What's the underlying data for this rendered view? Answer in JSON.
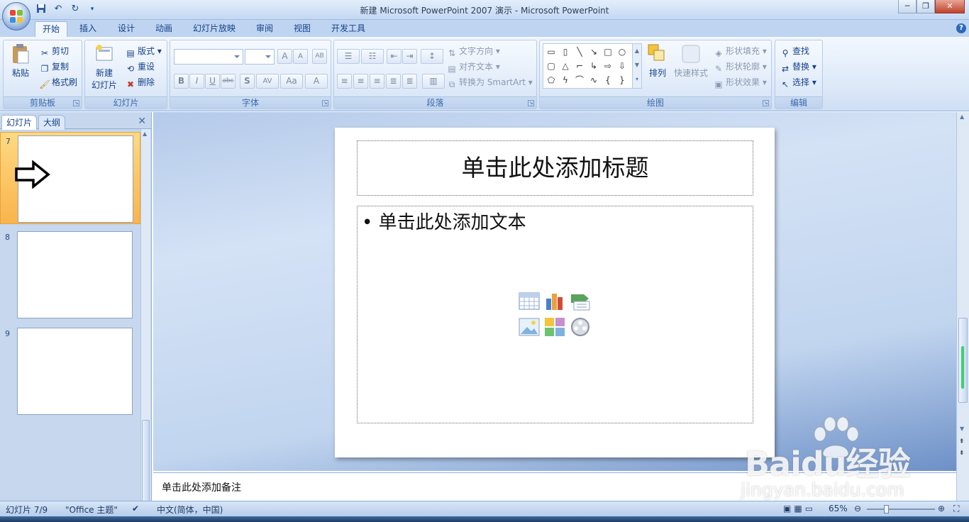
{
  "window": {
    "title": "新建 Microsoft PowerPoint 2007 演示 - Microsoft PowerPoint",
    "minimize": "─",
    "restore": "❐",
    "close": "✕"
  },
  "qat": {
    "save_icon": "save-icon",
    "undo_icon": "undo-icon",
    "redo_icon": "redo-icon",
    "customize_icon": "customize-icon"
  },
  "tabs": [
    "开始",
    "插入",
    "设计",
    "动画",
    "幻灯片放映",
    "审阅",
    "视图",
    "开发工具"
  ],
  "help_label": "?",
  "ribbon": {
    "clipboard": {
      "label": "剪贴板",
      "paste": "粘贴",
      "cut": "剪切",
      "copy": "复制",
      "format_painter": "格式刷"
    },
    "slides": {
      "label": "幻灯片",
      "new_slide": "新建\n幻灯片",
      "new_line1": "新建",
      "new_line2": "幻灯片",
      "layout": "版式",
      "reset": "重设",
      "delete": "删除"
    },
    "font": {
      "label": "字体",
      "family": "",
      "size": "",
      "bold": "B",
      "italic": "I",
      "underline": "U",
      "strike": "abc",
      "shadow": "S",
      "spacing": "AV",
      "case": "Aa",
      "color": "A",
      "grow": "A",
      "shrink": "A",
      "clear": "AB"
    },
    "paragraph": {
      "label": "段落",
      "text_direction": "文字方向",
      "align_text": "对齐文本",
      "smartart": "转换为 SmartArt"
    },
    "drawing": {
      "label": "绘图",
      "arrange": "排列",
      "quick_styles": "快速样式",
      "shape_fill": "形状填充",
      "shape_outline": "形状轮廓",
      "shape_effects": "形状效果"
    },
    "editing": {
      "label": "编辑",
      "find": "查找",
      "replace": "替换",
      "select": "选择"
    }
  },
  "panel": {
    "tab_slides": "幻灯片",
    "tab_outline": "大纲",
    "close": "✕",
    "thumbnails": [
      {
        "number": "7",
        "selected": true
      },
      {
        "number": "8",
        "selected": false
      },
      {
        "number": "9",
        "selected": false
      }
    ]
  },
  "slide": {
    "title_placeholder": "单击此处添加标题",
    "body_placeholder": "• 单击此处添加文本"
  },
  "notes": {
    "placeholder": "单击此处添加备注"
  },
  "status": {
    "slide_count": "幻灯片 7/9",
    "theme": "\"Office 主题\"",
    "language": "中文(简体，中国)",
    "zoom": "65%"
  },
  "watermark": {
    "brand": "Baidu经验",
    "url": "jingyan.baidu.com"
  },
  "colors": {
    "accent": "#15428b",
    "ribbon_bg": "#dbe8f8",
    "selected_thumb": "#f9b44c"
  }
}
